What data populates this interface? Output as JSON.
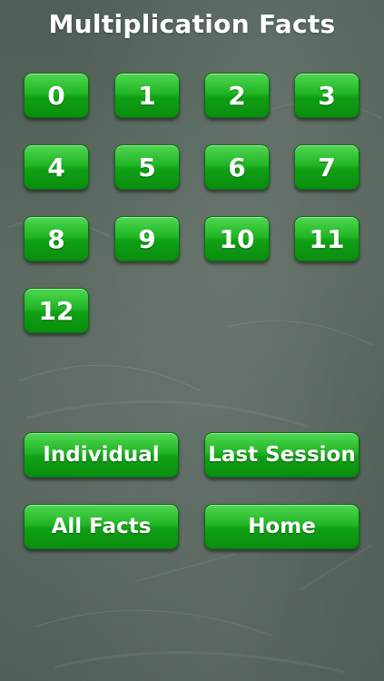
{
  "header": {
    "title": "Multiplication Facts"
  },
  "numbers": [
    "0",
    "1",
    "2",
    "3",
    "4",
    "5",
    "6",
    "7",
    "8",
    "9",
    "10",
    "11",
    "12"
  ],
  "actions": {
    "individual_label": "Individual",
    "last_session_label": "Last Session",
    "all_facts_label": "All Facts",
    "home_label": "Home"
  },
  "colors": {
    "button_green": "#1db022",
    "board_gray_green": "#55645b"
  }
}
